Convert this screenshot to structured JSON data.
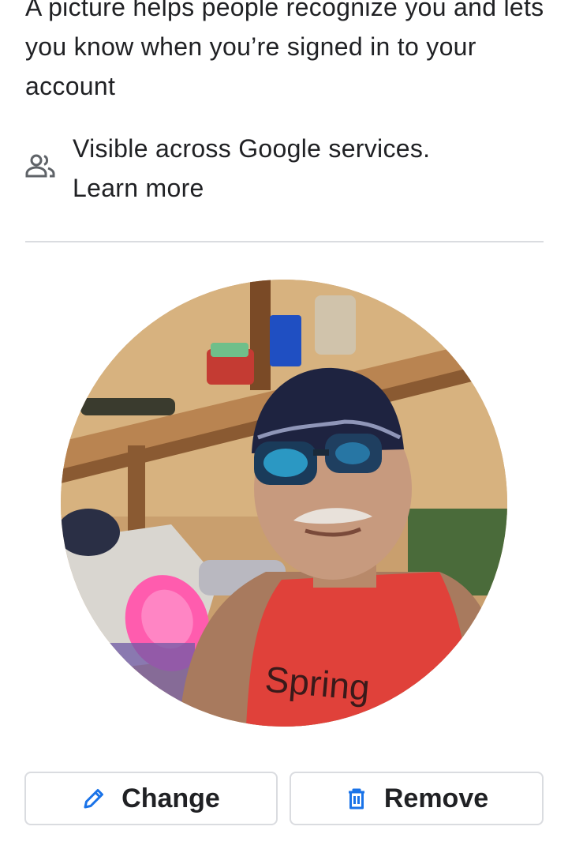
{
  "intro": {
    "text": "A picture helps people recognize you and lets you know when you’re signed in to your account"
  },
  "visibility": {
    "icon": "people-icon",
    "line1": "Visible across Google services.",
    "link": "Learn more"
  },
  "profile_photo": {
    "shirt_text": "Spring"
  },
  "actions": {
    "change_label": "Change",
    "change_icon": "pencil-icon",
    "remove_label": "Remove",
    "remove_icon": "trash-icon",
    "icon_color": "#1a73e8"
  }
}
